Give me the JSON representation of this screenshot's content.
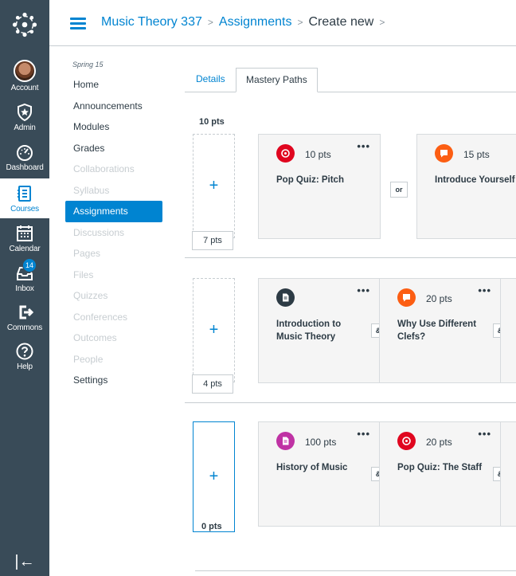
{
  "global_nav": {
    "items": [
      {
        "label": "Account",
        "icon": "avatar"
      },
      {
        "label": "Admin",
        "icon": "shield-icon"
      },
      {
        "label": "Dashboard",
        "icon": "dashboard-icon"
      },
      {
        "label": "Courses",
        "icon": "courses-icon"
      },
      {
        "label": "Calendar",
        "icon": "calendar-icon"
      },
      {
        "label": "Inbox",
        "icon": "inbox-icon",
        "badge": "14"
      },
      {
        "label": "Commons",
        "icon": "commons-icon"
      },
      {
        "label": "Help",
        "icon": "help-icon"
      }
    ],
    "collapse_glyph": "|←"
  },
  "breadcrumb": {
    "course": "Music Theory 337",
    "section": "Assignments",
    "current": "Create new"
  },
  "course_nav": {
    "term": "Spring 15",
    "items": [
      {
        "label": "Home",
        "state": "normal"
      },
      {
        "label": "Announcements",
        "state": "normal"
      },
      {
        "label": "Modules",
        "state": "normal"
      },
      {
        "label": "Grades",
        "state": "normal"
      },
      {
        "label": "Collaborations",
        "state": "muted"
      },
      {
        "label": "Syllabus",
        "state": "muted"
      },
      {
        "label": "Assignments",
        "state": "active"
      },
      {
        "label": "Discussions",
        "state": "muted"
      },
      {
        "label": "Pages",
        "state": "muted"
      },
      {
        "label": "Files",
        "state": "muted"
      },
      {
        "label": "Quizzes",
        "state": "muted"
      },
      {
        "label": "Conferences",
        "state": "muted"
      },
      {
        "label": "Outcomes",
        "state": "muted"
      },
      {
        "label": "People",
        "state": "muted"
      },
      {
        "label": "Settings",
        "state": "normal"
      }
    ]
  },
  "tabs": {
    "details": "Details",
    "mastery_paths": "Mastery Paths"
  },
  "ranges": [
    {
      "upper": "10 pts",
      "lower": "7 pts"
    },
    {
      "lower": "4 pts"
    },
    {
      "lower": "0 pts"
    }
  ],
  "add_glyph": "+",
  "menu_glyph": "•••",
  "connectors": {
    "or": "or",
    "and": "&"
  },
  "rows": [
    {
      "cards": [
        {
          "icon": "quiz-icon",
          "color": "#e0061f",
          "points": "10 pts",
          "title": [
            "Pop Quiz: Pitch"
          ]
        },
        {
          "icon": "discussion-icon",
          "color": "#fc5e13",
          "points": "15 pts",
          "title": [
            "Introduce Yourself"
          ]
        }
      ]
    },
    {
      "cards": [
        {
          "icon": "page-icon",
          "color": "#2d3b45",
          "points": "",
          "title": [
            "Introduction to",
            "Music Theory"
          ]
        },
        {
          "icon": "discussion-icon",
          "color": "#fc5e13",
          "points": "20 pts",
          "title": [
            "Why Use Different",
            "Clefs?"
          ]
        }
      ]
    },
    {
      "cards": [
        {
          "icon": "assignment-icon",
          "color": "#bf32a4",
          "points": "100 pts",
          "title": [
            "History of Music"
          ]
        },
        {
          "icon": "quiz-icon",
          "color": "#e0061f",
          "points": "20 pts",
          "title": [
            "Pop Quiz: The Staff"
          ]
        }
      ]
    }
  ]
}
